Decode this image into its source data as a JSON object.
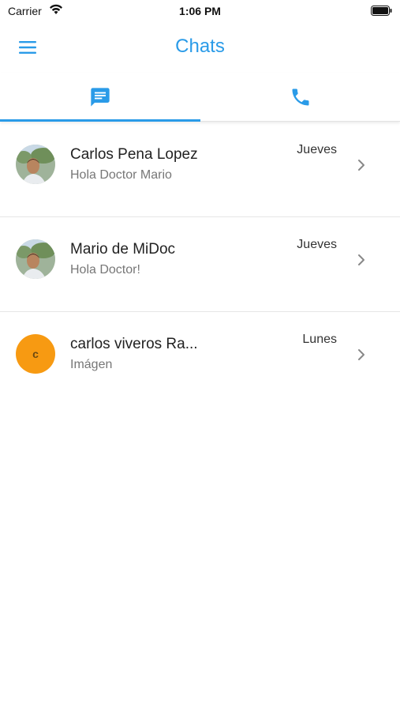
{
  "status_bar": {
    "carrier": "Carrier",
    "time": "1:06 PM"
  },
  "nav": {
    "title": "Chats",
    "menu_icon": "hamburger-menu-icon"
  },
  "tabs": [
    {
      "icon": "chat-bubble-icon",
      "active": true
    },
    {
      "icon": "phone-icon",
      "active": false
    }
  ],
  "colors": {
    "accent": "#2a9be8",
    "letter_avatar": "#f79a12"
  },
  "chats": [
    {
      "name": "Carlos Pena Lopez",
      "preview": "Hola Doctor Mario",
      "day": "Jueves",
      "avatar": "photo"
    },
    {
      "name": "Mario de MiDoc",
      "preview": "Hola Doctor!",
      "day": "Jueves",
      "avatar": "photo"
    },
    {
      "name": "carlos viveros Ra...",
      "preview": "Imágen",
      "day": "Lunes",
      "avatar": "letter",
      "avatar_letter": "c"
    }
  ]
}
